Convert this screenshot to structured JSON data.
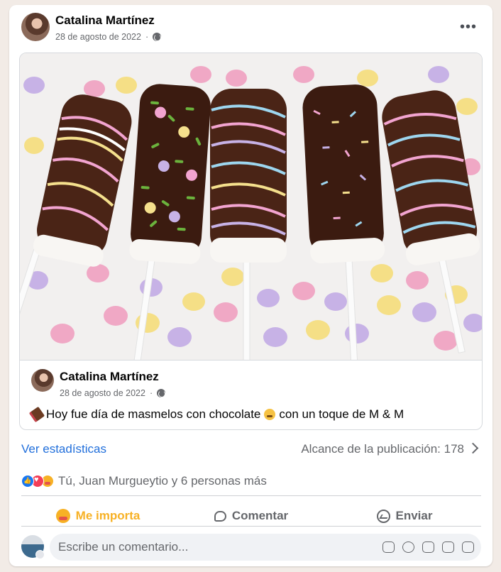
{
  "post": {
    "author": "Catalina Martínez",
    "date": "28 de agosto de 2022",
    "separator": "·",
    "more_label": "•••"
  },
  "shared": {
    "author": "Catalina Martínez",
    "date": "28 de agosto de 2022",
    "separator": "·",
    "caption_part1": "Hoy fue día de masmelos con chocolate",
    "caption_part2": "con un toque de M & M"
  },
  "stats": {
    "link": "Ver estadísticas",
    "reach": "Alcance de la publicación: 178"
  },
  "reactions": {
    "names": "Tú, Juan Murgueytio y 6 personas más"
  },
  "actions": {
    "care": "Me importa",
    "comment": "Comentar",
    "send": "Enviar"
  },
  "composer": {
    "placeholder": "Escribe un comentario..."
  },
  "colors": {
    "link": "#216fdb",
    "care_active": "#f7b125",
    "background": "#f2ebe6"
  }
}
